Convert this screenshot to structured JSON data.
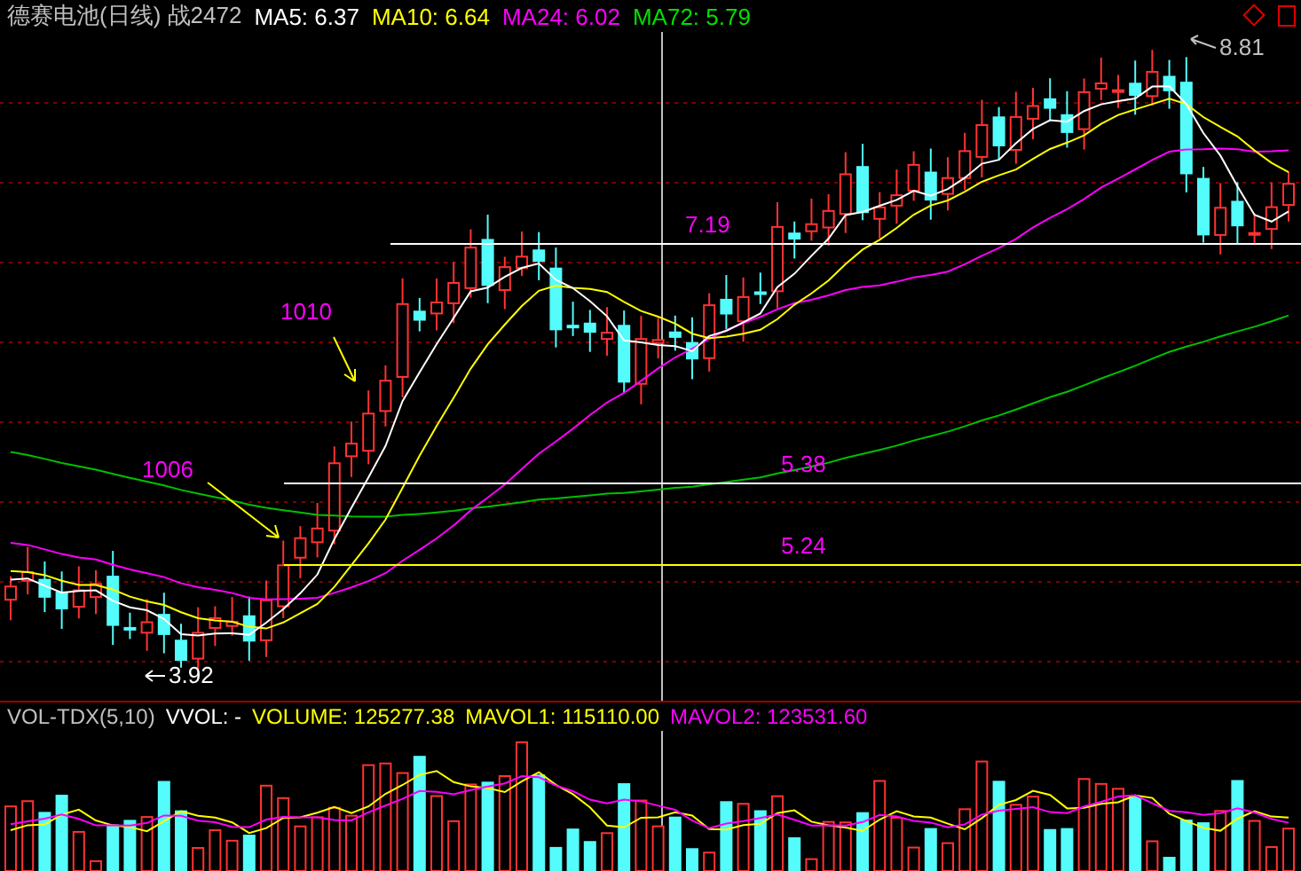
{
  "header": [
    {
      "label": "德赛电池(日线) 战2472",
      "color": "#c0c0c0"
    },
    {
      "label": "MA5: 6.37",
      "color": "#ffffff"
    },
    {
      "label": "MA10: 6.64",
      "color": "#ffff00"
    },
    {
      "label": "MA24: 6.02",
      "color": "#ff00ff"
    },
    {
      "label": "MA72: 5.79",
      "color": "#00e000"
    }
  ],
  "price_panel": {
    "annotations": [
      {
        "kind": "peak",
        "text": "8.81"
      },
      {
        "kind": "trough",
        "text": "3.92"
      },
      {
        "kind": "callout",
        "text": "1010"
      },
      {
        "kind": "callout",
        "text": "1006"
      }
    ],
    "levels": [
      {
        "label": "7.19",
        "color": "#ffffff"
      },
      {
        "label": "5.38",
        "color": "#ffffff"
      },
      {
        "label": "5.24",
        "color": "#ffff00"
      }
    ]
  },
  "volume_header": [
    {
      "label": "VOL-TDX(5,10)",
      "color": "#c0c0c0"
    },
    {
      "label": "VVOL: -",
      "color": "#ffffff"
    },
    {
      "label": "VOLUME: 125277.38",
      "color": "#ffff00"
    },
    {
      "label": "MAVOL1: 115110.00",
      "color": "#ffff00"
    },
    {
      "label": "MAVOL2: 123531.60",
      "color": "#ff00ff"
    }
  ]
}
